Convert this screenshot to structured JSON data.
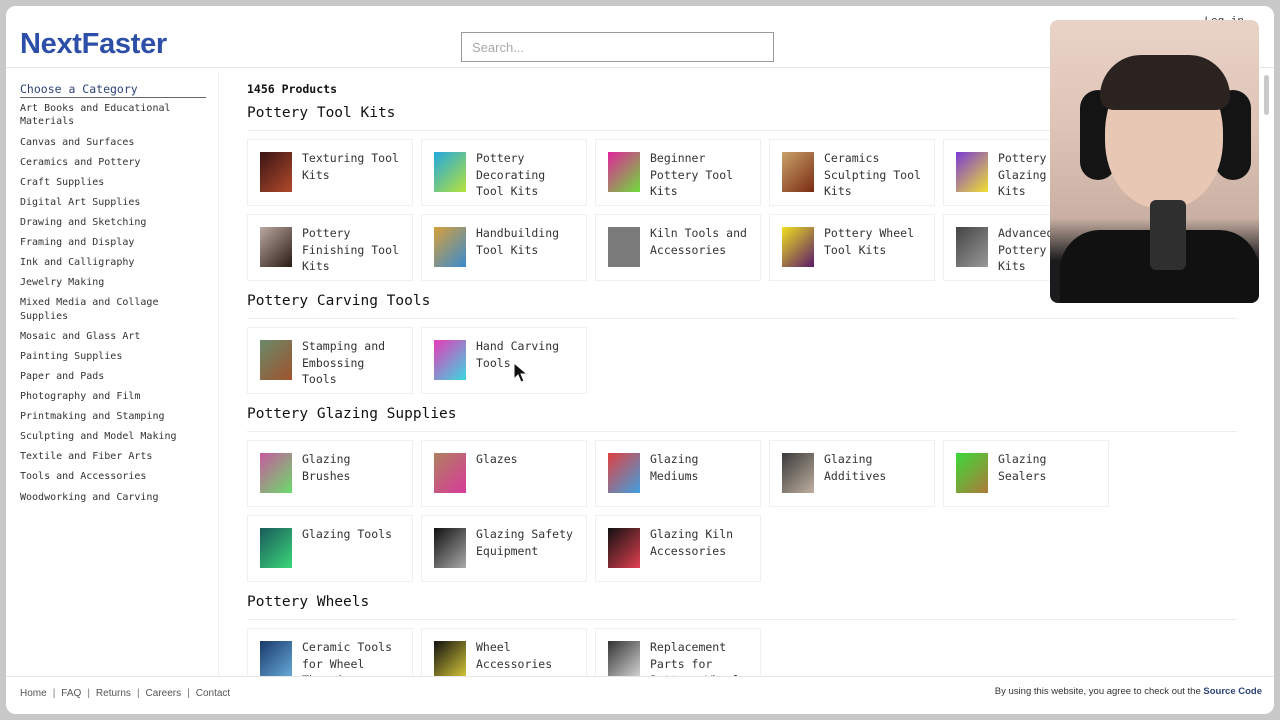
{
  "header": {
    "logo": "NextFaster",
    "search_placeholder": "Search...",
    "login_label": "Log in"
  },
  "sidebar": {
    "title": "Choose a Category",
    "items": [
      {
        "label": "Art Books and Educational Materials"
      },
      {
        "label": "Canvas and Surfaces"
      },
      {
        "label": "Ceramics and Pottery"
      },
      {
        "label": "Craft Supplies"
      },
      {
        "label": "Digital Art Supplies"
      },
      {
        "label": "Drawing and Sketching"
      },
      {
        "label": "Framing and Display"
      },
      {
        "label": "Ink and Calligraphy"
      },
      {
        "label": "Jewelry Making"
      },
      {
        "label": "Mixed Media and Collage Supplies"
      },
      {
        "label": "Mosaic and Glass Art"
      },
      {
        "label": "Painting Supplies"
      },
      {
        "label": "Paper and Pads"
      },
      {
        "label": "Photography and Film"
      },
      {
        "label": "Printmaking and Stamping"
      },
      {
        "label": "Sculpting and Model Making"
      },
      {
        "label": "Textile and Fiber Arts"
      },
      {
        "label": "Tools and Accessories"
      },
      {
        "label": "Woodworking and Carving"
      }
    ]
  },
  "main": {
    "product_count": "1456 Products",
    "sections": [
      {
        "title": "Pottery Tool Kits",
        "items": [
          {
            "label": "Texturing Tool Kits",
            "thumb_colors": [
              "#3a1414",
              "#b24a2a"
            ]
          },
          {
            "label": "Pottery Decorating Tool Kits",
            "thumb_colors": [
              "#22a7e0",
              "#b6e23a"
            ]
          },
          {
            "label": "Beginner Pottery Tool Kits",
            "thumb_colors": [
              "#e0239a",
              "#6fdc3a"
            ]
          },
          {
            "label": "Ceramics Sculpting Tool Kits",
            "thumb_colors": [
              "#c8a36a",
              "#7a2a12"
            ]
          },
          {
            "label": "Pottery Glazing Tool Kits",
            "thumb_colors": [
              "#7a3ad8",
              "#f0e030"
            ]
          },
          {
            "label": "Pottery Finishing Tool Kits",
            "thumb_colors": [
              "#b9a9a1",
              "#2a1a14"
            ]
          },
          {
            "label": "Handbuilding Tool Kits",
            "thumb_colors": [
              "#d7a03a",
              "#3a8ad0"
            ]
          },
          {
            "label": "Kiln Tools and Accessories",
            "thumb_colors": [
              "#7a7a7a",
              "#7a7a7a"
            ]
          },
          {
            "label": "Pottery Wheel Tool Kits",
            "thumb_colors": [
              "#f0e020",
              "#5a1a6a"
            ]
          },
          {
            "label": "Advanced Pottery Tool Kits",
            "thumb_colors": [
              "#444",
              "#999"
            ]
          }
        ]
      },
      {
        "title": "Pottery Carving Tools",
        "items": [
          {
            "label": "Stamping and Embossing Tools",
            "thumb_colors": [
              "#6a8a6a",
              "#a0522d"
            ]
          },
          {
            "label": "Hand Carving Tools",
            "thumb_colors": [
              "#e83ab8",
              "#3ad8e0"
            ]
          }
        ]
      },
      {
        "title": "Pottery Glazing Supplies",
        "items": [
          {
            "label": "Glazing Brushes",
            "thumb_colors": [
              "#c85aa0",
              "#6adc6a"
            ]
          },
          {
            "label": "Glazes",
            "thumb_colors": [
              "#b08060",
              "#d83a9a"
            ]
          },
          {
            "label": "Glazing Mediums",
            "thumb_colors": [
              "#e04040",
              "#40a0e0"
            ]
          },
          {
            "label": "Glazing Additives",
            "thumb_colors": [
              "#3a3a3a",
              "#c0b0a0"
            ]
          },
          {
            "label": "Glazing Sealers",
            "thumb_colors": [
              "#3ad83a",
              "#b07a3a"
            ]
          },
          {
            "label": "Glazing Tools",
            "thumb_colors": [
              "#1a5a5a",
              "#3ad87a"
            ]
          },
          {
            "label": "Glazing Safety Equipment",
            "thumb_colors": [
              "#111",
              "#aaa"
            ]
          },
          {
            "label": "Glazing Kiln Accessories",
            "thumb_colors": [
              "#111",
              "#e04050"
            ]
          }
        ]
      },
      {
        "title": "Pottery Wheels",
        "items": [
          {
            "label": "Ceramic Tools for Wheel Throwing",
            "thumb_colors": [
              "#1a3a6a",
              "#6ab0e0"
            ]
          },
          {
            "label": "Wheel Accessories",
            "thumb_colors": [
              "#111",
              "#e0d03a"
            ]
          },
          {
            "label": "Replacement Parts for Pottery Wheels",
            "thumb_colors": [
              "#333",
              "#ddd"
            ]
          }
        ]
      }
    ]
  },
  "footer": {
    "links": [
      {
        "label": "Home"
      },
      {
        "label": "FAQ"
      },
      {
        "label": "Returns"
      },
      {
        "label": "Careers"
      },
      {
        "label": "Contact"
      }
    ],
    "note": "By using this website, you agree to check out the",
    "source_link": "Source Code"
  },
  "colors": {
    "brand": "#2d4fa8",
    "category_title": "#2d4276"
  }
}
